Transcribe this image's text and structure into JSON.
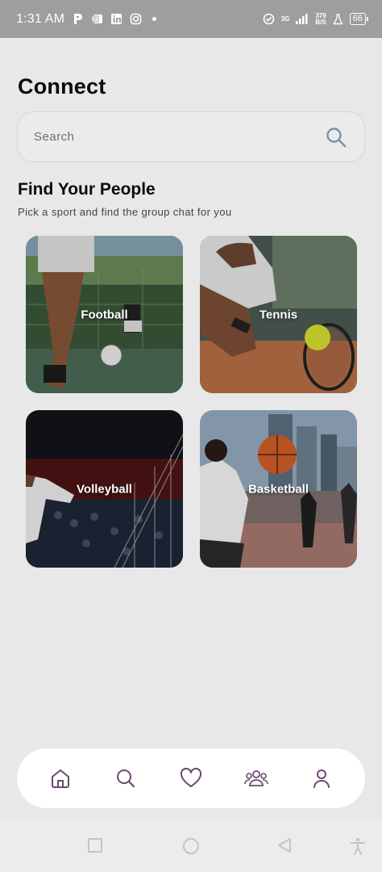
{
  "status_bar": {
    "time": "1:31 AM",
    "network_label": "3G",
    "speed_value": "379",
    "speed_unit": "B/S",
    "battery": "66"
  },
  "page": {
    "title": "Connect"
  },
  "search": {
    "placeholder": "Search"
  },
  "section": {
    "title": "Find Your People",
    "subtitle": "Pick a sport and find the group chat for you"
  },
  "sports": [
    {
      "label": "Football"
    },
    {
      "label": "Tennis"
    },
    {
      "label": "Volleyball"
    },
    {
      "label": "Basketball"
    }
  ],
  "bottom_nav": {
    "icons": [
      "home-icon",
      "search-icon",
      "heart-icon",
      "group-icon",
      "user-icon"
    ],
    "icon_color": "#6b4a6e"
  },
  "system_nav": {
    "icons": [
      "recent-apps-icon",
      "home-circle-icon",
      "back-icon",
      "accessibility-icon"
    ]
  }
}
